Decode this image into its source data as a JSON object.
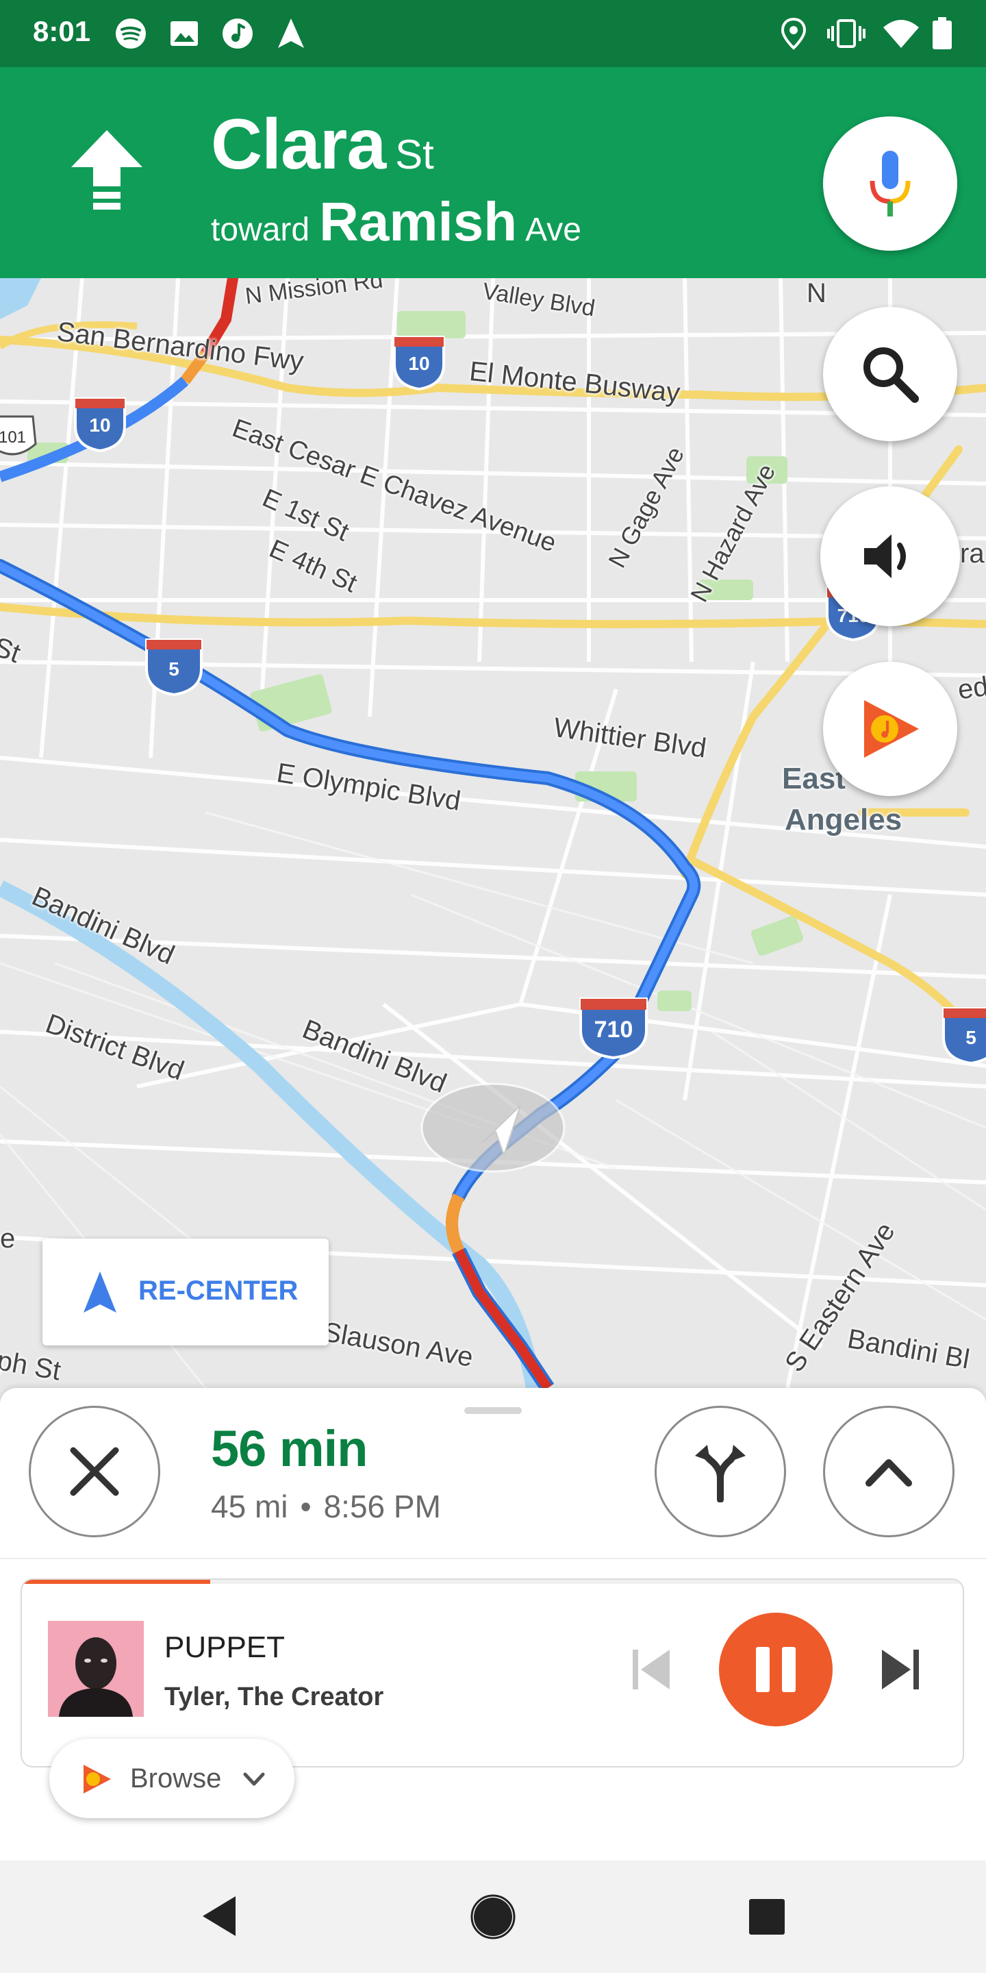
{
  "status_bar": {
    "time": "8:01",
    "left_icons": [
      "spotify-icon",
      "image-icon",
      "music-note-icon",
      "navigation-icon"
    ],
    "right_icons": [
      "location-icon",
      "vibrate-icon",
      "wifi-icon",
      "battery-icon"
    ]
  },
  "nav_header": {
    "maneuver": "straight",
    "street_name": "Clara",
    "street_suffix": "St",
    "toward_word": "toward",
    "toward_name": "Ramish",
    "toward_suffix": "Ave",
    "background_color": "#0f9d58"
  },
  "map": {
    "labels": [
      "N Mission Rd",
      "Valley Blvd",
      "San Bernardino Fwy",
      "El Monte Busway",
      "East Cesar E Chavez Avenue",
      "E 1st St",
      "E 4th St",
      "N Gage Ave",
      "N Hazard Ave",
      "Whittier Blvd",
      "E Olympic Blvd",
      "East",
      "Angeles",
      "Bandini Blvd",
      "District Blvd",
      "Bandini Blvd",
      "S Eastern Ave",
      "Bandini Bl",
      "Slauson Ave",
      "ph St",
      "St",
      "e",
      "ra",
      "edr",
      "N"
    ],
    "shields": [
      "10",
      "10",
      "5",
      "710",
      "710",
      "5",
      "101"
    ],
    "buttons": [
      "search-icon",
      "sound-icon",
      "play-music-icon"
    ],
    "recenter_label": "RE-CENTER",
    "route_color": "#4285f4",
    "traffic_heavy_color": "#d93025",
    "traffic_moderate_color": "#f29b3a"
  },
  "trip": {
    "duration": "56 min",
    "distance": "45 mi",
    "separator": "•",
    "arrival": "8:56 PM"
  },
  "media": {
    "title": "PUPPET",
    "artist": "Tyler, The Creator",
    "progress": 0.2,
    "accent_color": "#ee5a2a",
    "browse_label": "Browse"
  }
}
